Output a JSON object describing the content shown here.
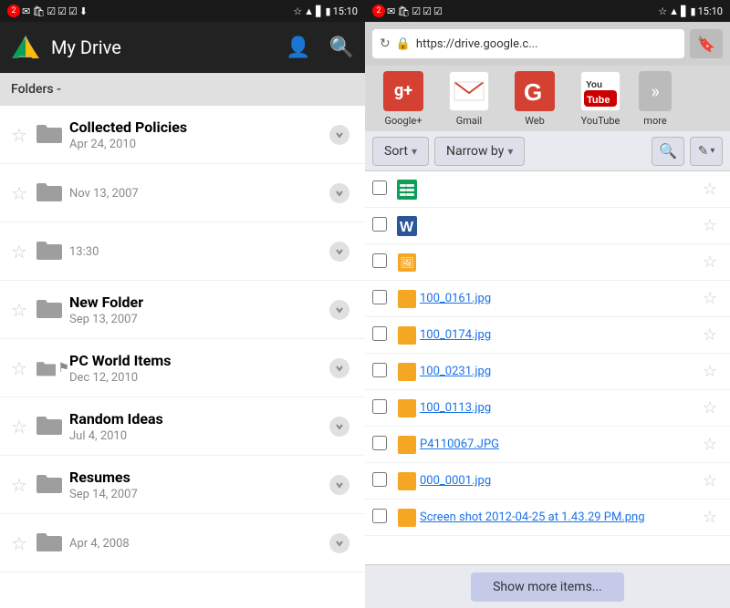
{
  "left": {
    "statusBar": {
      "time": "15:10",
      "badge": "2"
    },
    "appBar": {
      "title": "My Drive"
    },
    "toolbar": {
      "label": "Folders -"
    },
    "folders": [
      {
        "id": 1,
        "name": "Collected Policies",
        "date": "Apr 24, 2010",
        "starred": false,
        "flagged": false
      },
      {
        "id": 2,
        "name": "",
        "date": "Nov 13, 2007",
        "starred": false,
        "flagged": false
      },
      {
        "id": 3,
        "name": "",
        "date": "13:30",
        "starred": false,
        "flagged": false
      },
      {
        "id": 4,
        "name": "New Folder",
        "date": "Sep 13, 2007",
        "starred": false,
        "flagged": false
      },
      {
        "id": 5,
        "name": "PC World Items",
        "date": "Dec 12, 2010",
        "starred": false,
        "flagged": true
      },
      {
        "id": 6,
        "name": "Random Ideas",
        "date": "Jul 4, 2010",
        "starred": false,
        "flagged": false
      },
      {
        "id": 7,
        "name": "Resumes",
        "date": "Sep 14, 2007",
        "starred": false,
        "flagged": false
      },
      {
        "id": 8,
        "name": "",
        "date": "Apr 4, 2008",
        "starred": false,
        "flagged": false
      }
    ]
  },
  "right": {
    "statusBar": {
      "time": "15:10",
      "badge": "2"
    },
    "browser": {
      "url": "https://drive.google.c...",
      "lockIcon": "🔒"
    },
    "bookmarks": [
      {
        "id": "gplus",
        "label": "Google+",
        "bg": "#d44132",
        "text": "g+",
        "textColor": "white"
      },
      {
        "id": "gmail",
        "label": "Gmail",
        "bg": "#fff",
        "text": "M",
        "textColor": "#d44132"
      },
      {
        "id": "web",
        "label": "Web",
        "bg": "#d44132",
        "text": "g",
        "textColor": "white"
      },
      {
        "id": "youtube",
        "label": "YouTube",
        "bg": "#fff",
        "text": "▶",
        "textColor": "#cc0000"
      },
      {
        "id": "more",
        "label": "more",
        "bg": "#999",
        "text": "≫",
        "textColor": "white"
      }
    ],
    "filterBar": {
      "sortLabel": "Sort",
      "narrowLabel": "Narrow by"
    },
    "files": [
      {
        "id": 1,
        "name": "",
        "type": "sheets",
        "checked": false
      },
      {
        "id": 2,
        "name": "",
        "type": "word",
        "checked": false
      },
      {
        "id": 3,
        "name": "",
        "type": "image",
        "checked": false
      },
      {
        "id": 4,
        "name": "100_0161.jpg",
        "type": "image",
        "checked": false
      },
      {
        "id": 5,
        "name": "100_0174.jpg",
        "type": "image",
        "checked": false
      },
      {
        "id": 6,
        "name": "100_0231.jpg",
        "type": "image",
        "checked": false
      },
      {
        "id": 7,
        "name": "100_0113.jpg",
        "type": "image",
        "checked": false
      },
      {
        "id": 8,
        "name": "P4110067.JPG",
        "type": "image",
        "checked": false
      },
      {
        "id": 9,
        "name": "000_0001.jpg",
        "type": "image",
        "checked": false
      },
      {
        "id": 10,
        "name": "Screen shot 2012-04-25 at 1.43.29 PM.png",
        "type": "image",
        "checked": false
      }
    ],
    "showMoreLabel": "Show more items..."
  },
  "icons": {
    "star": "☆",
    "starFilled": "★",
    "chevronDown": "⌄",
    "folder": "📁",
    "search": "🔍",
    "edit": "✎",
    "lock": "🔒",
    "bookmark": "🔖",
    "flag": "⚑",
    "more": "≫"
  }
}
